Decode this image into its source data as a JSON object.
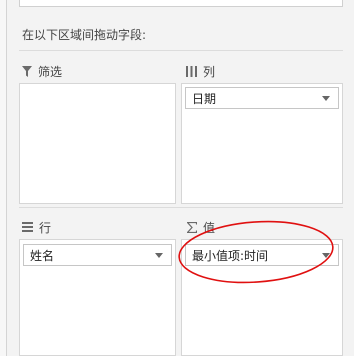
{
  "instruction": "在以下区域间拖动字段:",
  "filters": {
    "title": "筛选",
    "icon": "filter-icon"
  },
  "columns": {
    "title": "列",
    "icon": "columns-icon",
    "fields": [
      {
        "label": "日期"
      }
    ]
  },
  "rows": {
    "title": "行",
    "icon": "rows-icon",
    "fields": [
      {
        "label": "姓名"
      }
    ]
  },
  "values": {
    "title": "值",
    "icon": "sigma-icon",
    "fields": [
      {
        "label": "最小值项:时间"
      }
    ]
  },
  "colors": {
    "highlight_ellipse": "#e01010"
  }
}
